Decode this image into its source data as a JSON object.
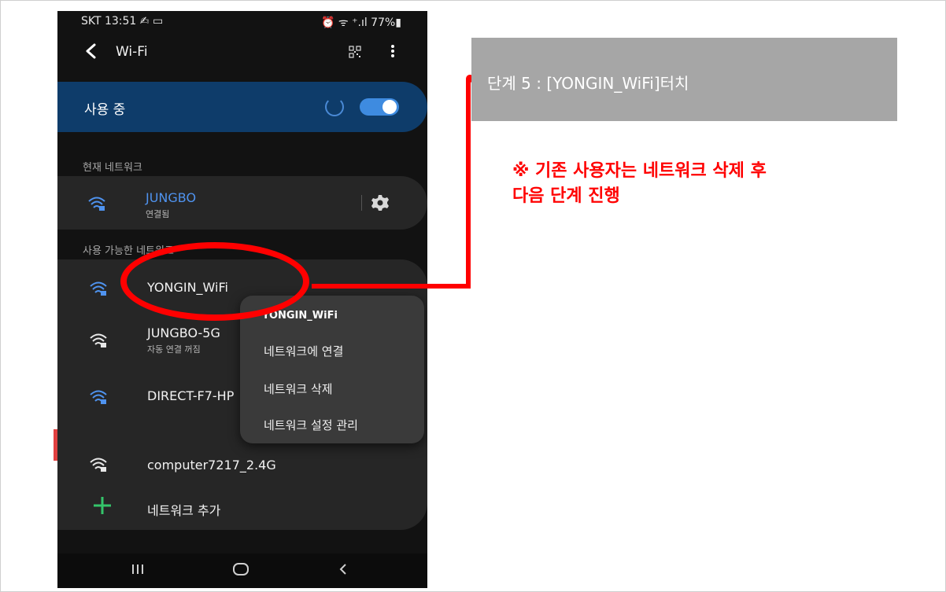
{
  "status_bar": {
    "left": "SKT 13:51 ✍ ▭",
    "right": "⏰ ᯤ ⁺.ıl 77%▮"
  },
  "app_bar": {
    "back_icon": "chevron-left-icon",
    "title": "Wi-Fi",
    "qr_icon": "qr-code-icon",
    "more_icon": "more-vert-icon"
  },
  "master_toggle": {
    "label": "사용 중",
    "state": "on"
  },
  "current_section": {
    "label": "현재 네트워크",
    "network": {
      "name": "JUNGBO",
      "status": "연결됨",
      "settings_icon": "gear-icon"
    }
  },
  "available_section": {
    "label": "사용 가능한 네트워크",
    "networks": [
      {
        "name": "YONGIN_WiFi",
        "sub": ""
      },
      {
        "name": "JUNGBO-5G",
        "sub": "자동 연결 꺼짐"
      },
      {
        "name": "DIRECT-F7-HP",
        "sub": ""
      },
      {
        "name": "computer7217_2.4G",
        "sub": ""
      }
    ],
    "add_label": "네트워크 추가"
  },
  "context_menu": {
    "title": "YONGIN_WiFi",
    "items": [
      "네트워크에 연결",
      "네트워크 삭제",
      "네트워크 설정 관리"
    ]
  },
  "nav_bar": {
    "icons": [
      "recent-apps-icon",
      "home-icon",
      "back-icon"
    ]
  },
  "callout": {
    "text": "단계 5 : [YONGIN_WiFi]터치"
  },
  "notice": {
    "line1": "※ 기존 사용자는 네트워크 삭제 후",
    "line2": "다음 단계 진행"
  },
  "colors": {
    "accent_blue": "#3e8be0",
    "toggle_card": "#0e3c6a",
    "annotation_red": "#ff0000",
    "callout_gray": "#a6a6a6"
  }
}
